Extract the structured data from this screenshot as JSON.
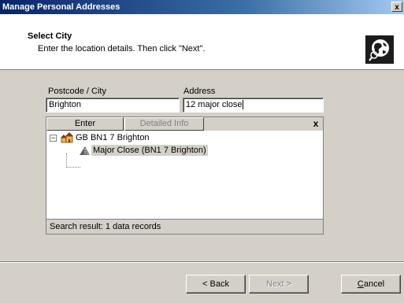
{
  "window": {
    "title": "Manage Personal Addresses",
    "close_glyph": "x"
  },
  "header": {
    "title": "Select City",
    "subtitle": "Enter the location details. Then click \"Next\".",
    "icon": "globe-icon"
  },
  "form": {
    "postcode_label": "Postcode / City",
    "postcode_value": "Brighton",
    "address_label": "Address",
    "address_value": "12 major close"
  },
  "results": {
    "enter_label": "Enter",
    "detailed_info_label": "Detailed Info",
    "close_glyph": "x",
    "tree": [
      {
        "label": "GB BN1 7 Brighton",
        "expander": "−",
        "icon": "city-buildings-icon"
      },
      {
        "label": "Major Close (BN1 7 Brighton)",
        "icon": "street-icon"
      }
    ],
    "status": "Search result: 1 data records"
  },
  "buttons": {
    "back": "< Back",
    "next": "Next >",
    "cancel_prefix": "",
    "cancel_underlined": "C",
    "cancel_rest": "ancel"
  }
}
